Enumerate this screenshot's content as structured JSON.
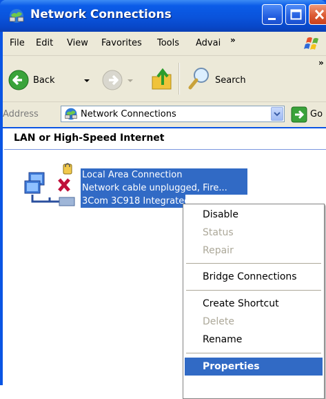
{
  "window": {
    "title": "Network Connections"
  },
  "menubar": {
    "items": [
      "File",
      "Edit",
      "View",
      "Favorites",
      "Tools",
      "Advai"
    ],
    "overflow": "»"
  },
  "toolbar": {
    "back_label": "Back",
    "search_label": "Search",
    "overflow": "»"
  },
  "address": {
    "label": "Address",
    "value": "Network Connections",
    "go_label": "Go"
  },
  "content": {
    "section_header": "LAN or High-Speed Internet",
    "connection": {
      "name": "Local Area Connection",
      "status": "Network cable unplugged, Fire...",
      "device": "3Com 3C918 Integrated Fast..."
    }
  },
  "context_menu": {
    "items": [
      {
        "label": "Disable",
        "enabled": true
      },
      {
        "label": "Status",
        "enabled": false
      },
      {
        "label": "Repair",
        "enabled": false
      },
      {
        "label": "Bridge Connections",
        "enabled": true
      },
      {
        "label": "Create Shortcut",
        "enabled": true
      },
      {
        "label": "Delete",
        "enabled": false
      },
      {
        "label": "Rename",
        "enabled": true
      },
      {
        "label": "Properties",
        "enabled": true,
        "highlighted": true
      }
    ]
  },
  "colors": {
    "titlebar": "#0a53db",
    "selection": "#316ac5",
    "chrome": "#ece9d8",
    "disabled_text": "#aca899"
  }
}
